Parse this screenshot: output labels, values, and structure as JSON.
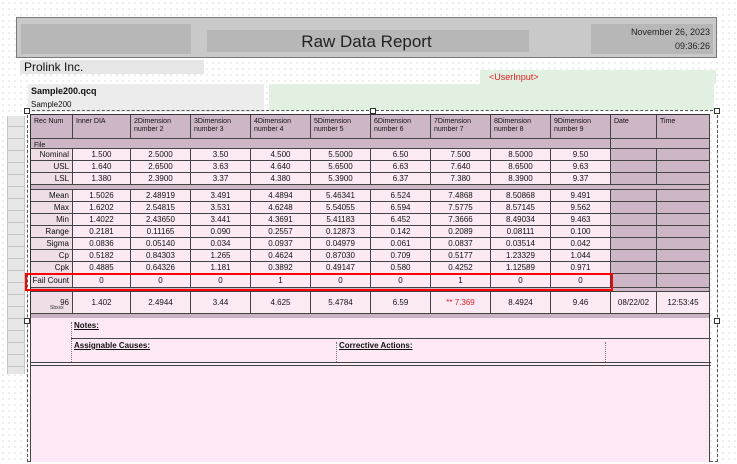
{
  "report": {
    "title": "Raw Data Report",
    "date": "November 26, 2023",
    "time": "09:36:26",
    "company": "Prolink Inc.",
    "user_input": "<UserInput>",
    "file": "Sample200.qcq",
    "sample": "Sample200"
  },
  "columns": [
    {
      "label": "Rec Num"
    },
    {
      "label": "Inner DIA"
    },
    {
      "label": "2Dimension number 2"
    },
    {
      "label": "3Dimension number 3"
    },
    {
      "label": "4Dimension number 4"
    },
    {
      "label": "5Dimension number 5"
    },
    {
      "label": "6Dimension number 6"
    },
    {
      "label": "7Dimension number 7"
    },
    {
      "label": "8Dimension number 8"
    },
    {
      "label": "9Dimension number 9"
    },
    {
      "label": "Date"
    },
    {
      "label": "Time"
    }
  ],
  "file_label": "File",
  "spec_rows": [
    {
      "label": "Nominal",
      "values": [
        "1.500",
        "2.5000",
        "3.50",
        "4.500",
        "5.5000",
        "6.50",
        "7.500",
        "8.5000",
        "9.50"
      ]
    },
    {
      "label": "USL",
      "values": [
        "1.640",
        "2.6500",
        "3.63",
        "4.640",
        "5.6500",
        "6.63",
        "7.640",
        "8.6500",
        "9.63"
      ]
    },
    {
      "label": "LSL",
      "values": [
        "1.380",
        "2.3900",
        "3.37",
        "4.380",
        "5.3900",
        "6.37",
        "7.380",
        "8.3900",
        "9.37"
      ]
    }
  ],
  "stat_rows": [
    {
      "label": "Mean",
      "values": [
        "1.5026",
        "2.48919",
        "3.491",
        "4.4894",
        "5.46341",
        "6.524",
        "7.4868",
        "8.50868",
        "9.491"
      ]
    },
    {
      "label": "Max",
      "values": [
        "1.6202",
        "2.54815",
        "3.531",
        "4.6248",
        "5.54055",
        "6.594",
        "7.5775",
        "8.57145",
        "9.562"
      ]
    },
    {
      "label": "Min",
      "values": [
        "1.4022",
        "2.43650",
        "3.441",
        "4.3691",
        "5.41183",
        "6.452",
        "7.3666",
        "8.49034",
        "9.463"
      ]
    },
    {
      "label": "Range",
      "values": [
        "0.2181",
        "0.11165",
        "0.090",
        "0.2557",
        "0.12873",
        "0.142",
        "0.2089",
        "0.08111",
        "0.100"
      ]
    },
    {
      "label": "Sigma",
      "values": [
        "0.0836",
        "0.05140",
        "0.034",
        "0.0937",
        "0.04979",
        "0.061",
        "0.0837",
        "0.03514",
        "0.042"
      ]
    },
    {
      "label": "Cp",
      "values": [
        "0.5182",
        "0.84303",
        "1.265",
        "0.4624",
        "0.87030",
        "0.709",
        "0.5177",
        "1.23329",
        "1.044"
      ]
    },
    {
      "label": "Cpk",
      "values": [
        "0.4885",
        "0.64326",
        "1.181",
        "0.3892",
        "0.49147",
        "0.580",
        "0.4252",
        "1.12589",
        "0.971"
      ]
    }
  ],
  "fail_row": {
    "label": "Fail Count",
    "values": [
      "0",
      "0",
      "0",
      "1",
      "0",
      "0",
      "1",
      "0",
      "0"
    ]
  },
  "data_row": {
    "rec": "96",
    "sub": "Sbxxx",
    "values": [
      "1.402",
      "2.4944",
      "3.44",
      "4.625",
      "5.4784",
      "6.59",
      "** 7.369",
      "8.4924",
      "9.46"
    ],
    "date": "08/22/02",
    "time": "12:53:45"
  },
  "notes": {
    "notes_label": "Notes:",
    "assignable_label": "Assignable Causes:",
    "corrective_label": "Corrective Actions:"
  },
  "colors": {
    "highlight": "#ff0000",
    "out_of_spec": "#e02020",
    "table_bg": "#c9b3c2"
  }
}
